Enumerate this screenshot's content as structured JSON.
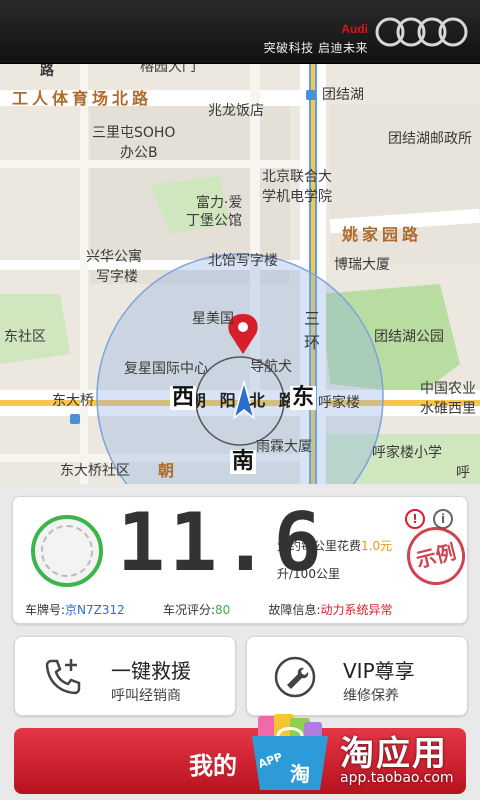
{
  "header": {
    "brand_name": "Audi",
    "slogan": "突破科技 启迪未来"
  },
  "map": {
    "labels": {
      "road_top_left": "路",
      "top_cut": "榕园大门",
      "tuanjiehu_station": "团结湖",
      "gongti_north_road": "工人体育场北路",
      "zhaolong_hotel": "兆龙饭店",
      "sanlitun_soho": "三里屯SOHO",
      "office_b": "办公B",
      "post_office": "团结湖邮政所",
      "bjlu": "北京联合大",
      "bjlu2": "学机电学院",
      "fuli1": "富力·爱",
      "fuli2": "丁堡公馆",
      "yaojiayuan_road": "姚家园路",
      "xinghua1": "兴华公寓",
      "xinghua2": "写字楼",
      "beiyi": "北饴写字楼",
      "borui": "博瑞大厦",
      "dongshequ": "东社区",
      "xingmei": "星美国",
      "tuanjiehu_park": "团结湖公园",
      "fuxing": "复星国际中心",
      "daohangquan": "导航犬",
      "third_ring1": "三",
      "third_ring2": "环",
      "dongdaqiao": "东大桥",
      "chaoyang_road": "朝 阳 北 路",
      "west_dir": "西",
      "east_dir": "东",
      "hujialou": "呼家楼",
      "agri_bank1": "中国农业",
      "agri_bank2": "水碓西里",
      "yulin": "雨霖大厦",
      "south_dir": "南",
      "dongdaqiao_community": "东大桥社区",
      "chao": "朝",
      "hujialou_school": "呼家楼小学",
      "hu_cut": "呼"
    }
  },
  "dashboard": {
    "fuel_value": "11.6",
    "cost_label": "大约每公里花费",
    "cost_value": "1.0元",
    "unit_label": "升/100公里",
    "plate_label": "车牌号:",
    "plate_value": "京N7Z312",
    "score_label": "车况评分:",
    "score_value": "80",
    "fault_label": "故障信息:",
    "fault_value": "动力系统异常",
    "stamp_text": "示例",
    "bolt_icon": "!",
    "info_icon": "i"
  },
  "actions": {
    "rescue_title": "一键救援",
    "rescue_sub": "呼叫经销商",
    "vip_title": "VIP尊享",
    "vip_sub": "维修保养"
  },
  "bottom": {
    "label": "我的"
  },
  "watermark": {
    "title": "淘应用",
    "url": "app.taobao.com",
    "bag_badge": "APP",
    "bag_char": "淘"
  },
  "colors": {
    "accent_red": "#d81e2b",
    "green": "#3cb54a",
    "blue": "#2a6fd0"
  }
}
